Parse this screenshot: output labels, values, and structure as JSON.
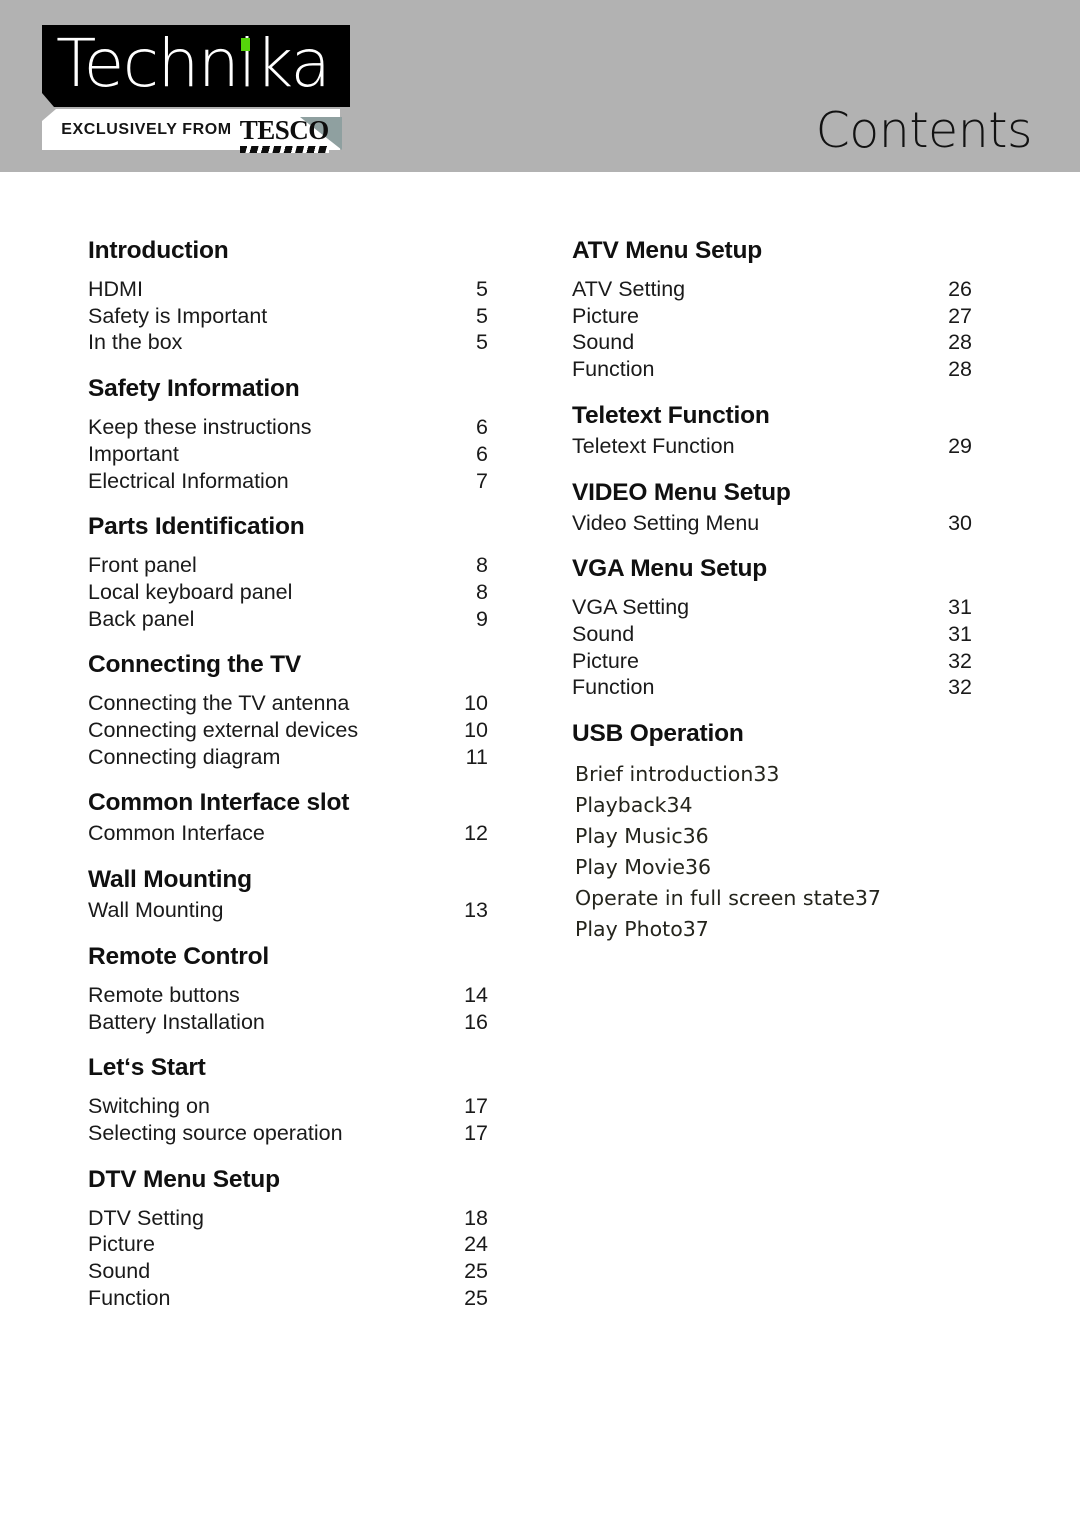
{
  "header": {
    "title": "Contents",
    "band_color": "#b2b2b2",
    "logo": {
      "wordmark": "Technika",
      "i_dot_color": "#55d40b",
      "tagline_prefix": "EXCLUSIVELY FROM",
      "retailer": "TESCO"
    }
  },
  "columns": {
    "left": [
      {
        "heading": "Introduction",
        "entries": [
          {
            "label": "HDMI",
            "page": "5"
          },
          {
            "label": "Safety is Important",
            "page": "5"
          },
          {
            "label": "In the box",
            "page": "5"
          }
        ]
      },
      {
        "heading": "Safety Information",
        "entries": [
          {
            "label": "Keep these instructions",
            "page": "6"
          },
          {
            "label": "Important",
            "page": "6"
          },
          {
            "label": "Electrical  Information",
            "page": "7"
          }
        ]
      },
      {
        "heading": "Parts Identification",
        "entries": [
          {
            "label": "Front panel",
            "page": "8"
          },
          {
            "label": "Local keyboard panel",
            "page": "8"
          },
          {
            "label": "Back panel",
            "page": "9"
          }
        ]
      },
      {
        "heading": "Connecting the TV",
        "entries": [
          {
            "label": "Connecting the TV antenna",
            "page": "10"
          },
          {
            "label": "Connecting external devices",
            "page": "10"
          },
          {
            "label": "Connecting diagram",
            "page": "11"
          }
        ]
      },
      {
        "heading": "Common Interface slot",
        "entries": [
          {
            "label": "Common Interface",
            "page": "12"
          }
        ]
      },
      {
        "heading": "Wall Mounting",
        "entries": [
          {
            "label": "Wall Mounting",
            "page": "13"
          }
        ]
      },
      {
        "heading": "Remote Control",
        "entries": [
          {
            "label": "Remote buttons",
            "page": "14"
          },
          {
            "label": "Battery Installation",
            "page": "16"
          }
        ]
      },
      {
        "heading": "Let‘s Start",
        "entries": [
          {
            "label": "Switching on",
            "page": "17"
          },
          {
            "label": "Selecting source operation",
            "page": "17"
          }
        ]
      },
      {
        "heading": "DTV Menu Setup",
        "entries": [
          {
            "label": "DTV Setting",
            "page": "18"
          },
          {
            "label": "Picture",
            "page": "24"
          },
          {
            "label": "Sound",
            "page": "25"
          },
          {
            "label": "Function",
            "page": "25"
          }
        ]
      }
    ],
    "right": [
      {
        "heading": "ATV Menu Setup",
        "entries": [
          {
            "label": "ATV Setting",
            "page": "26"
          },
          {
            "label": "Picture",
            "page": "27"
          },
          {
            "label": "Sound",
            "page": "28"
          },
          {
            "label": "Function",
            "page": "28"
          }
        ]
      },
      {
        "heading": "Teletext Function",
        "entries": [
          {
            "label": "Teletext Function",
            "page": "29"
          }
        ]
      },
      {
        "heading": "VIDEO Menu Setup",
        "entries": [
          {
            "label": "Video Setting Menu",
            "page": "30"
          }
        ]
      },
      {
        "heading": "VGA Menu Setup",
        "entries": [
          {
            "label": "VGA Setting",
            "page": "31"
          },
          {
            "label": "Sound",
            "page": "31"
          },
          {
            "label": "Picture",
            "page": "32"
          },
          {
            "label": "Function",
            "page": "32"
          }
        ]
      },
      {
        "heading": "USB Operation",
        "style": "concatenated",
        "entries": [
          {
            "label": "Brief introduction",
            "page": "33"
          },
          {
            "label": "Playback",
            "page": "34"
          },
          {
            "label": "Play Music",
            "page": "36"
          },
          {
            "label": "Play Movie",
            "page": "36"
          },
          {
            "label": "Operate in full screen state",
            "page": "37"
          },
          {
            "label": "Play Photo",
            "page": "37"
          }
        ]
      }
    ]
  }
}
